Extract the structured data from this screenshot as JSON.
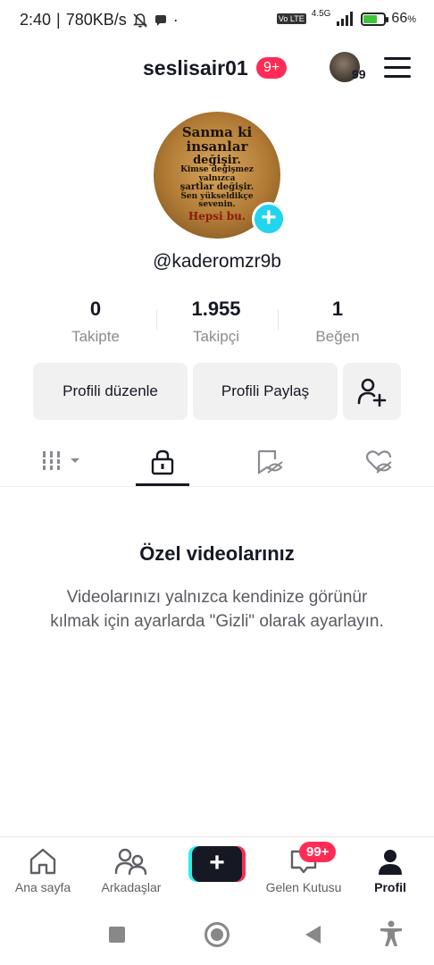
{
  "status_bar": {
    "time": "2:40",
    "speed": "780KB/s",
    "net_type": "4.5G",
    "volte": "Vo LTE",
    "battery_percent": "66",
    "battery_unit": "%",
    "battery_level": 0.66
  },
  "header": {
    "username": "seslisair01",
    "notification_badge": "9+",
    "avatar_count": "99"
  },
  "profile": {
    "picture_text": [
      "Sanma ki insanlar",
      "değişir.",
      "Kimse değişmez yalnızca",
      "şartlar değişir.",
      "Sen yükseldikçe sevenin.",
      "Hepsi bu."
    ],
    "handle": "@kaderomzr9b"
  },
  "stats": [
    {
      "value": "0",
      "label": "Takipte"
    },
    {
      "value": "1.955",
      "label": "Takipçi"
    },
    {
      "value": "1",
      "label": "Beğen"
    }
  ],
  "actions": {
    "edit_profile": "Profili düzenle",
    "share_profile": "Profili Paylaş"
  },
  "tabs": {
    "icons": [
      "grid-dropdown-icon",
      "lock-icon",
      "bookmark-eye-icon",
      "heart-eye-icon"
    ],
    "active_index": 1
  },
  "empty_state": {
    "title": "Özel videolarınız",
    "description": "Videolarınızı yalnızca kendinize görünür kılmak için ayarlarda \"Gizli\" olarak ayarlayın."
  },
  "bottom_nav": {
    "home": "Ana sayfa",
    "friends": "Arkadaşlar",
    "create": "+",
    "inbox": "Gelen Kutusu",
    "inbox_badge": "99+",
    "profile": "Profil"
  },
  "colors": {
    "accent_red": "#fe2c55",
    "accent_cyan": "#25f4ee",
    "plus_blue": "#20d5ec",
    "text_primary": "#161823"
  }
}
